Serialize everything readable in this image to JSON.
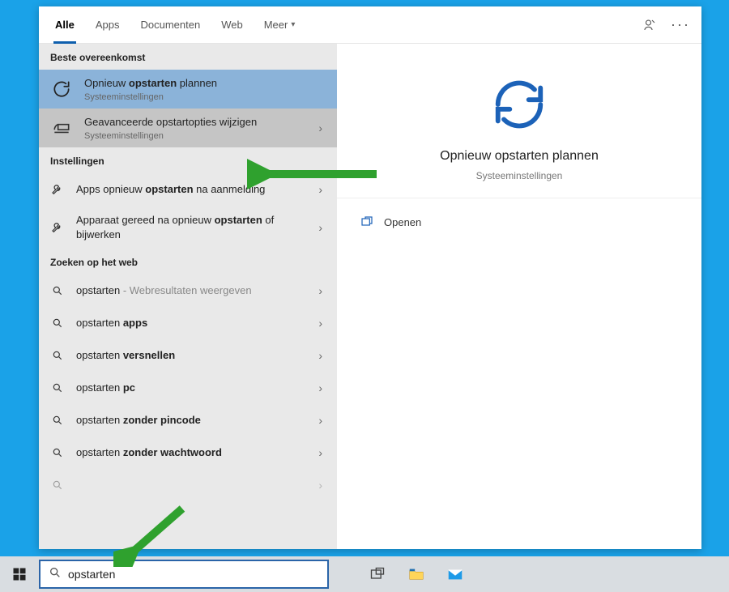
{
  "tabs": {
    "all": "Alle",
    "apps": "Apps",
    "documents": "Documenten",
    "web": "Web",
    "more": "Meer"
  },
  "sections": {
    "best_match": "Beste overeenkomst",
    "settings": "Instellingen",
    "web_search": "Zoeken op het web"
  },
  "best_match": [
    {
      "title_pre": "Opnieuw ",
      "title_bold": "opstarten",
      "title_post": " plannen",
      "subtitle": "Systeeminstellingen"
    },
    {
      "title_plain": "Geavanceerde opstartopties wijzigen",
      "subtitle": "Systeeminstellingen"
    }
  ],
  "settings_results": [
    {
      "pre": "Apps opnieuw ",
      "bold": "opstarten",
      "post": " na aanmelding"
    },
    {
      "pre": "Apparaat gereed na opnieuw ",
      "bold": "opstarten",
      "post": " of bijwerken"
    }
  ],
  "web_results": [
    {
      "term": "opstarten",
      "suffix_light": " - Webresultaten weergeven"
    },
    {
      "term": "opstarten ",
      "bold": "apps"
    },
    {
      "term": "opstarten ",
      "bold": "versnellen"
    },
    {
      "term": "opstarten ",
      "bold": "pc"
    },
    {
      "term": "opstarten ",
      "bold": "zonder pincode"
    },
    {
      "term": "opstarten ",
      "bold": "zonder wachtwoord"
    }
  ],
  "detail": {
    "title": "Opnieuw opstarten plannen",
    "subtitle": "Systeeminstellingen",
    "open_label": "Openen"
  },
  "search": {
    "value": "opstarten"
  },
  "colors": {
    "accent": "#0e5fad",
    "arrow": "#2fa12e"
  }
}
